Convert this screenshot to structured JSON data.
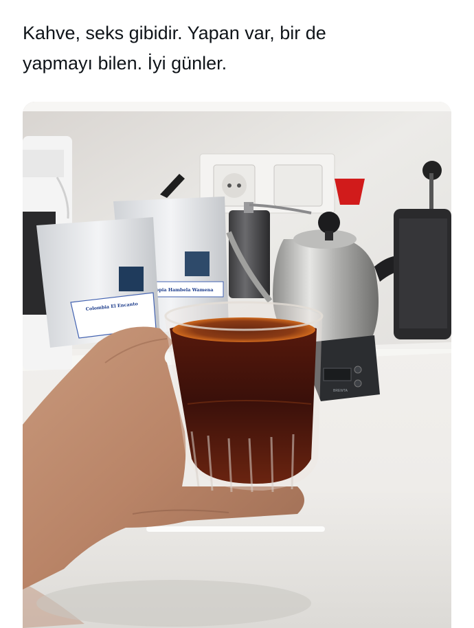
{
  "tweet": {
    "text_line1": "Kahve, seks gibidir. Yapan var, bir de",
    "text_line2": "yapmayı bilen. İyi günler."
  },
  "media": {
    "bag_left_label": "Colombia El Encanto",
    "bag_right_label": "opia Hambela Wamena",
    "scale_brand": "BREWTA",
    "colors": {
      "wall": "#e9e7e4",
      "counter": "#f2f0ee",
      "coffee": "#3a120a",
      "crema": "#b8551a",
      "grinder_knob": "#d11b1b"
    }
  }
}
